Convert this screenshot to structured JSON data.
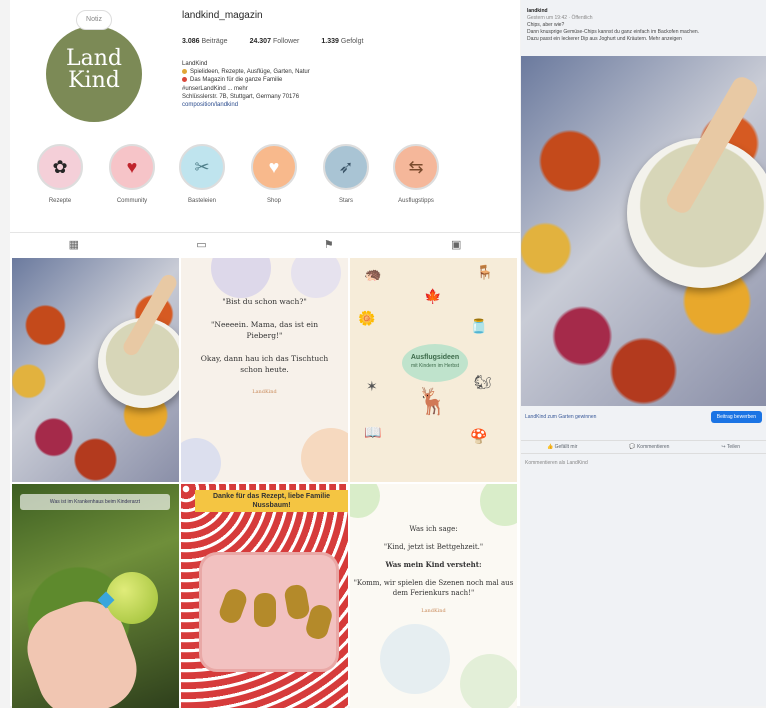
{
  "instagram": {
    "username": "landkind_magazin",
    "avatar": {
      "line1": "Land",
      "line2": "Kind",
      "bubble": "Notiz"
    },
    "stats": [
      {
        "value": "3.086",
        "label": "Beiträge"
      },
      {
        "value": "24.307",
        "label": "Follower"
      },
      {
        "value": "1.339",
        "label": "Gefolgt"
      }
    ],
    "bio": {
      "name": "LandKind",
      "line1": "Spielideen, Rezepte, Ausflüge, Garten, Natur",
      "line2": "Das Magazin für die ganze Familie",
      "line3": "#unserLandKind ... mehr",
      "line4": "Schlüsslerstr. 7B, Stuttgart, Germany 70176",
      "link": "composition/landkind"
    },
    "highlights": [
      {
        "label": "Rezepte",
        "icon": "flower-icon",
        "color": "#f4cfd8"
      },
      {
        "label": "Community",
        "icon": "heart-icon",
        "color": "#f6c4c8"
      },
      {
        "label": "Basteleien",
        "icon": "scissors-icon",
        "color": "#bfe4ee"
      },
      {
        "label": "Shop",
        "icon": "shop-icon",
        "color": "#f8b98c"
      },
      {
        "label": "Stars",
        "icon": "bird-icon",
        "color": "#a9c4d4"
      },
      {
        "label": "Ausflugstipps",
        "icon": "signpost-icon",
        "color": "#f5b79a"
      }
    ],
    "tabs": [
      "grid",
      "reels",
      "saved",
      "tagged"
    ],
    "posts": {
      "quote1": {
        "q": "\"Bist du schon wach?\"",
        "a": "\"Neeeein. Mama, das ist ein Pieberg!\"",
        "c": "Okay, dann hau ich das Tischtuch schon heute.",
        "sig": "LandKind"
      },
      "info": {
        "title": "Ausflugsideen",
        "sub": "mit Kindern im Herbst"
      },
      "apple_banner": "Was ist im Krankenhaus beim Kinderarzt",
      "recipe_tag": "Danke für das Rezept, liebe Familie Nussbaum!",
      "quote2": {
        "q": "Was ich sage:",
        "qa": "\"Kind, jetzt ist Bettgehzeit.\"",
        "h": "Was mein Kind versteht:",
        "ha": "\"Komm, wir spielen die Szenen noch mal aus dem Ferienkurs nach!\"",
        "sig": "LandKind"
      }
    }
  },
  "facebook": {
    "page": "landkind",
    "meta": "Gestern um 19:42 · Öffentlich",
    "text1": "Chips, aber wie?",
    "text2": "Dann knusprige Gemüse-Chips kannst du ganz einfach im Backofen machen.",
    "text3": "Dazu passt ein leckerer Dip aus Joghurt und Kräutern. Mehr anzeigen",
    "cta_link": "LandKind zum Garten gewinnen",
    "cta_btn": "Beitrag bewerben",
    "actions": [
      "Gefällt mir",
      "Kommentieren",
      "Teilen"
    ],
    "comment_hint": "Kommentieren als LandKind"
  }
}
